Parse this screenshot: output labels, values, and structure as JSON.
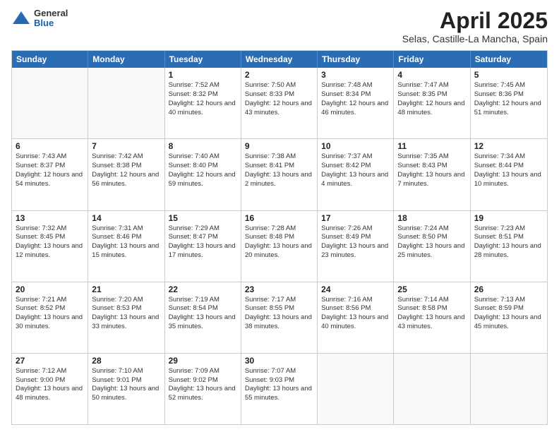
{
  "header": {
    "logo": {
      "general": "General",
      "blue": "Blue"
    },
    "title": "April 2025",
    "subtitle": "Selas, Castille-La Mancha, Spain"
  },
  "calendar": {
    "days_of_week": [
      "Sunday",
      "Monday",
      "Tuesday",
      "Wednesday",
      "Thursday",
      "Friday",
      "Saturday"
    ],
    "weeks": [
      [
        {
          "day": "",
          "empty": true
        },
        {
          "day": "",
          "empty": true
        },
        {
          "day": "1",
          "sunrise": "7:52 AM",
          "sunset": "8:32 PM",
          "daylight": "12 hours and 40 minutes."
        },
        {
          "day": "2",
          "sunrise": "7:50 AM",
          "sunset": "8:33 PM",
          "daylight": "12 hours and 43 minutes."
        },
        {
          "day": "3",
          "sunrise": "7:48 AM",
          "sunset": "8:34 PM",
          "daylight": "12 hours and 46 minutes."
        },
        {
          "day": "4",
          "sunrise": "7:47 AM",
          "sunset": "8:35 PM",
          "daylight": "12 hours and 48 minutes."
        },
        {
          "day": "5",
          "sunrise": "7:45 AM",
          "sunset": "8:36 PM",
          "daylight": "12 hours and 51 minutes."
        }
      ],
      [
        {
          "day": "6",
          "sunrise": "7:43 AM",
          "sunset": "8:37 PM",
          "daylight": "12 hours and 54 minutes."
        },
        {
          "day": "7",
          "sunrise": "7:42 AM",
          "sunset": "8:38 PM",
          "daylight": "12 hours and 56 minutes."
        },
        {
          "day": "8",
          "sunrise": "7:40 AM",
          "sunset": "8:40 PM",
          "daylight": "12 hours and 59 minutes."
        },
        {
          "day": "9",
          "sunrise": "7:38 AM",
          "sunset": "8:41 PM",
          "daylight": "13 hours and 2 minutes."
        },
        {
          "day": "10",
          "sunrise": "7:37 AM",
          "sunset": "8:42 PM",
          "daylight": "13 hours and 4 minutes."
        },
        {
          "day": "11",
          "sunrise": "7:35 AM",
          "sunset": "8:43 PM",
          "daylight": "13 hours and 7 minutes."
        },
        {
          "day": "12",
          "sunrise": "7:34 AM",
          "sunset": "8:44 PM",
          "daylight": "13 hours and 10 minutes."
        }
      ],
      [
        {
          "day": "13",
          "sunrise": "7:32 AM",
          "sunset": "8:45 PM",
          "daylight": "13 hours and 12 minutes."
        },
        {
          "day": "14",
          "sunrise": "7:31 AM",
          "sunset": "8:46 PM",
          "daylight": "13 hours and 15 minutes."
        },
        {
          "day": "15",
          "sunrise": "7:29 AM",
          "sunset": "8:47 PM",
          "daylight": "13 hours and 17 minutes."
        },
        {
          "day": "16",
          "sunrise": "7:28 AM",
          "sunset": "8:48 PM",
          "daylight": "13 hours and 20 minutes."
        },
        {
          "day": "17",
          "sunrise": "7:26 AM",
          "sunset": "8:49 PM",
          "daylight": "13 hours and 23 minutes."
        },
        {
          "day": "18",
          "sunrise": "7:24 AM",
          "sunset": "8:50 PM",
          "daylight": "13 hours and 25 minutes."
        },
        {
          "day": "19",
          "sunrise": "7:23 AM",
          "sunset": "8:51 PM",
          "daylight": "13 hours and 28 minutes."
        }
      ],
      [
        {
          "day": "20",
          "sunrise": "7:21 AM",
          "sunset": "8:52 PM",
          "daylight": "13 hours and 30 minutes."
        },
        {
          "day": "21",
          "sunrise": "7:20 AM",
          "sunset": "8:53 PM",
          "daylight": "13 hours and 33 minutes."
        },
        {
          "day": "22",
          "sunrise": "7:19 AM",
          "sunset": "8:54 PM",
          "daylight": "13 hours and 35 minutes."
        },
        {
          "day": "23",
          "sunrise": "7:17 AM",
          "sunset": "8:55 PM",
          "daylight": "13 hours and 38 minutes."
        },
        {
          "day": "24",
          "sunrise": "7:16 AM",
          "sunset": "8:56 PM",
          "daylight": "13 hours and 40 minutes."
        },
        {
          "day": "25",
          "sunrise": "7:14 AM",
          "sunset": "8:58 PM",
          "daylight": "13 hours and 43 minutes."
        },
        {
          "day": "26",
          "sunrise": "7:13 AM",
          "sunset": "8:59 PM",
          "daylight": "13 hours and 45 minutes."
        }
      ],
      [
        {
          "day": "27",
          "sunrise": "7:12 AM",
          "sunset": "9:00 PM",
          "daylight": "13 hours and 48 minutes."
        },
        {
          "day": "28",
          "sunrise": "7:10 AM",
          "sunset": "9:01 PM",
          "daylight": "13 hours and 50 minutes."
        },
        {
          "day": "29",
          "sunrise": "7:09 AM",
          "sunset": "9:02 PM",
          "daylight": "13 hours and 52 minutes."
        },
        {
          "day": "30",
          "sunrise": "7:07 AM",
          "sunset": "9:03 PM",
          "daylight": "13 hours and 55 minutes."
        },
        {
          "day": "",
          "empty": true
        },
        {
          "day": "",
          "empty": true
        },
        {
          "day": "",
          "empty": true
        }
      ]
    ]
  }
}
